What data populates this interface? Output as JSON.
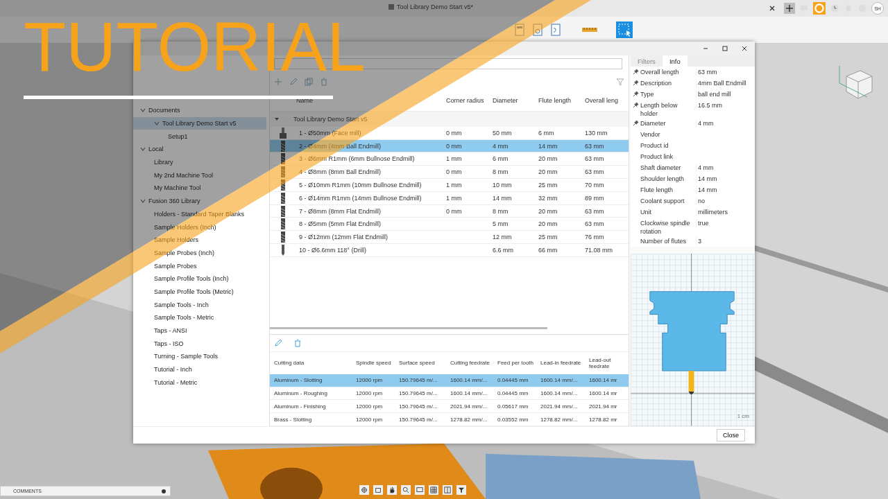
{
  "app": {
    "document_title": "Tool Library Demo Start v5*",
    "user_initials": "SH",
    "comments_label": "COMMENTS"
  },
  "overlay": {
    "title": "TUTORIAL"
  },
  "sidebar": {
    "items": [
      {
        "label": "Documents",
        "expanded": true,
        "selected": false,
        "children": [
          {
            "label": "Tool Library Demo Start v5",
            "expanded": true,
            "selected": true,
            "children": [
              {
                "label": "Setup1",
                "selected": false
              }
            ]
          }
        ]
      },
      {
        "label": "Local",
        "expanded": true,
        "selected": false,
        "children": [
          {
            "label": "Library",
            "selected": false
          },
          {
            "label": "My 2nd Machine Tool",
            "selected": false
          },
          {
            "label": "My Machine Tool",
            "selected": false
          }
        ]
      },
      {
        "label": "Fusion 360 Library",
        "expanded": true,
        "selected": false,
        "children": [
          {
            "label": "Holders - Standard Taper Blanks",
            "selected": false
          },
          {
            "label": "Sample Holders (Inch)",
            "selected": false
          },
          {
            "label": "Sample Holders",
            "selected": false
          },
          {
            "label": "Sample Probes (Inch)",
            "selected": false
          },
          {
            "label": "Sample Probes",
            "selected": false
          },
          {
            "label": "Sample Profile Tools (Inch)",
            "selected": false
          },
          {
            "label": "Sample Profile Tools (Metric)",
            "selected": false
          },
          {
            "label": "Sample Tools - Inch",
            "selected": false
          },
          {
            "label": "Sample Tools - Metric",
            "selected": false
          },
          {
            "label": "Taps - ANSI",
            "selected": false
          },
          {
            "label": "Taps - ISO",
            "selected": false
          },
          {
            "label": "Turning - Sample Tools",
            "selected": false
          },
          {
            "label": "Tutorial - Inch",
            "selected": false
          },
          {
            "label": "Tutorial - Metric",
            "selected": false
          }
        ]
      }
    ]
  },
  "tools": {
    "columns": [
      "Name",
      "Corner radius",
      "Diameter",
      "Flute length",
      "Overall leng"
    ],
    "group": "Tool Library Demo Start v5",
    "rows": [
      {
        "kind": "face-mill",
        "selected": false,
        "cells": [
          "1 - Ø50mm (Face mill)",
          "0 mm",
          "50 mm",
          "6 mm",
          "130 mm"
        ]
      },
      {
        "kind": "endmill",
        "selected": true,
        "cells": [
          "2 - Ø4mm (4mm Ball Endmill)",
          "0 mm",
          "4 mm",
          "14 mm",
          "63 mm"
        ]
      },
      {
        "kind": "endmill",
        "selected": false,
        "cells": [
          "3 - Ø6mm R1mm (6mm Bullnose Endmill)",
          "1 mm",
          "6 mm",
          "20 mm",
          "63 mm"
        ]
      },
      {
        "kind": "endmill",
        "selected": false,
        "cells": [
          "4 - Ø8mm (8mm Ball Endmill)",
          "0 mm",
          "8 mm",
          "20 mm",
          "63 mm"
        ]
      },
      {
        "kind": "endmill",
        "selected": false,
        "cells": [
          "5 - Ø10mm R1mm (10mm Bullnose Endmill)",
          "1 mm",
          "10 mm",
          "25 mm",
          "70 mm"
        ]
      },
      {
        "kind": "endmill",
        "selected": false,
        "cells": [
          "6 - Ø14mm R1mm (14mm Bullnose Endmill)",
          "1 mm",
          "14 mm",
          "32 mm",
          "89 mm"
        ]
      },
      {
        "kind": "endmill",
        "selected": false,
        "cells": [
          "7 - Ø8mm (8mm Flat Endmill)",
          "0 mm",
          "8 mm",
          "20 mm",
          "63 mm"
        ]
      },
      {
        "kind": "endmill",
        "selected": false,
        "cells": [
          "8 - Ø5mm (5mm Flat Endmill)",
          "",
          "5 mm",
          "20 mm",
          "63 mm"
        ]
      },
      {
        "kind": "endmill",
        "selected": false,
        "cells": [
          "9 - Ø12mm (12mm Flat Endmill)",
          "",
          "12 mm",
          "25 mm",
          "76 mm"
        ]
      },
      {
        "kind": "drill",
        "selected": false,
        "cells": [
          "10 - Ø6.6mm 118° (Drill)",
          "",
          "6.6 mm",
          "66 mm",
          "71.08 mm"
        ]
      }
    ]
  },
  "info": {
    "tabs": [
      {
        "label": "Filters",
        "selected": false
      },
      {
        "label": "Info",
        "selected": true
      }
    ],
    "rows": [
      {
        "label": "Overall length",
        "value": "63 mm",
        "pinned": true
      },
      {
        "label": "Description",
        "value": "4mm Ball Endmill",
        "pinned": true
      },
      {
        "label": "Type",
        "value": "ball end mill",
        "pinned": true
      },
      {
        "label": "Length below holder",
        "value": "16.5 mm",
        "pinned": true
      },
      {
        "label": "Diameter",
        "value": "4 mm",
        "pinned": true
      },
      {
        "label": "Vendor",
        "value": "",
        "pinned": false
      },
      {
        "label": "Product id",
        "value": "",
        "pinned": false
      },
      {
        "label": "Product link",
        "value": "",
        "pinned": false
      },
      {
        "label": "Shaft diameter",
        "value": "4 mm",
        "pinned": false
      },
      {
        "label": "Shoulder length",
        "value": "14 mm",
        "pinned": false
      },
      {
        "label": "Flute length",
        "value": "14 mm",
        "pinned": false
      },
      {
        "label": "Coolant support",
        "value": "no",
        "pinned": false
      },
      {
        "label": "Unit",
        "value": "millimeters",
        "pinned": false
      },
      {
        "label": "Clockwise spindle rotation",
        "value": "true",
        "pinned": false
      },
      {
        "label": "Number of flutes",
        "value": "3",
        "pinned": false
      }
    ],
    "scale_label": "1 cm"
  },
  "cutting": {
    "columns": [
      "Cutting data",
      "Spindle speed",
      "Surface speed",
      "Cutting feedrate",
      "Feed per tooth",
      "Lead-in feedrate",
      "Lead-out feedrate"
    ],
    "rows": [
      {
        "selected": true,
        "cells": [
          "Aluminum - Slotting",
          "12000 rpm",
          "150.79645 m/...",
          "1600.14 mm/...",
          "0.04445 mm",
          "1600.14 mm/...",
          "1600.14 mr"
        ]
      },
      {
        "selected": false,
        "cells": [
          "Aluminum - Roughing",
          "12000 rpm",
          "150.79645 m/...",
          "1600.14 mm/...",
          "0.04445 mm",
          "1600.14 mm/...",
          "1600.14 mr"
        ]
      },
      {
        "selected": false,
        "cells": [
          "Aluminum - Finishing",
          "12000 rpm",
          "150.79645 m/...",
          "2021.94 mm/...",
          "0.05617 mm",
          "2021.94 mm/...",
          "2021.94 mr"
        ]
      },
      {
        "selected": false,
        "cells": [
          "Brass - Slotting",
          "12000 rpm",
          "150.79645 m/...",
          "1278.82 mm/...",
          "0.03552 mm",
          "1278.82 mm/...",
          "1278.82 mr"
        ]
      }
    ]
  },
  "close_button": "Close"
}
